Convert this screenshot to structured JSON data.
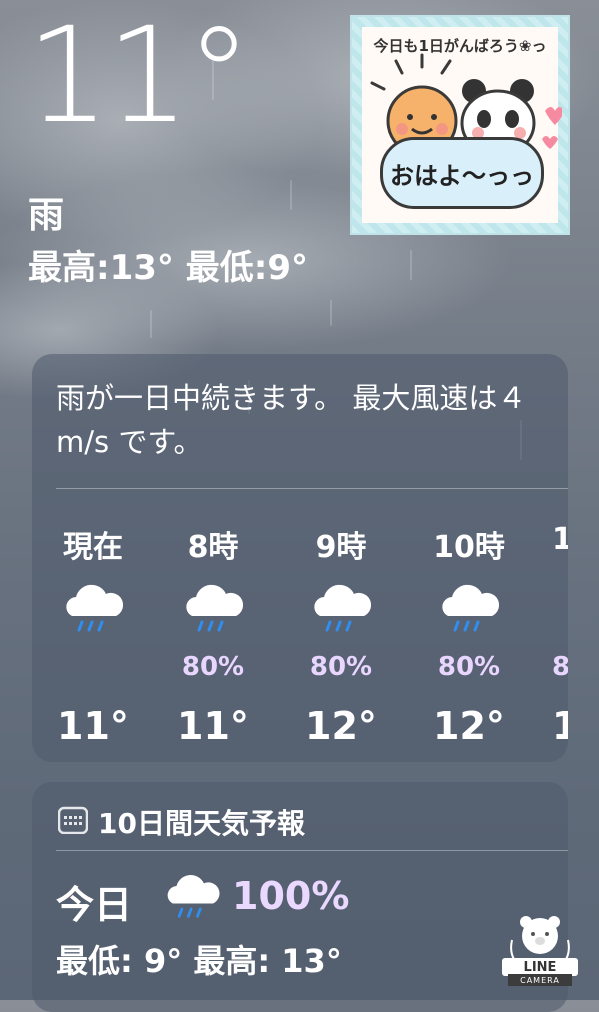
{
  "current": {
    "temperature": "11°",
    "condition": "雨",
    "high_low": "最高:13°  最低:9°"
  },
  "sticker": {
    "top_text": "今日も1日がんばろう❀っ",
    "bubble_text": "おはよ〜っっ"
  },
  "hourly_card": {
    "summary": "雨が一日中続きます。 最大風速は４m/s です。",
    "hours": [
      {
        "label": "現在",
        "icon": "rain-cloud-icon",
        "precip": "",
        "temp": "11°"
      },
      {
        "label": "8時",
        "icon": "rain-cloud-icon",
        "precip": "80%",
        "temp": "11°"
      },
      {
        "label": "9時",
        "icon": "rain-cloud-icon",
        "precip": "80%",
        "temp": "12°"
      },
      {
        "label": "10時",
        "icon": "rain-cloud-icon",
        "precip": "80%",
        "temp": "12°"
      },
      {
        "label": "1",
        "icon": "",
        "precip": "8",
        "temp": "1"
      }
    ]
  },
  "forecast_card": {
    "title": "10日間天気予報",
    "icon": "calendar-icon",
    "today": {
      "day": "今日",
      "icon": "rain-cloud-icon",
      "precip": "100%",
      "low_high": "最低: 9°  最高: 13°"
    }
  },
  "watermark": {
    "line1": "LINE",
    "line2": "CAMERA"
  },
  "colors": {
    "precip_text": "#e9d6ff",
    "card_bg": "rgba(78,90,108,0.55)",
    "rain_drop": "#2f8ff0"
  }
}
